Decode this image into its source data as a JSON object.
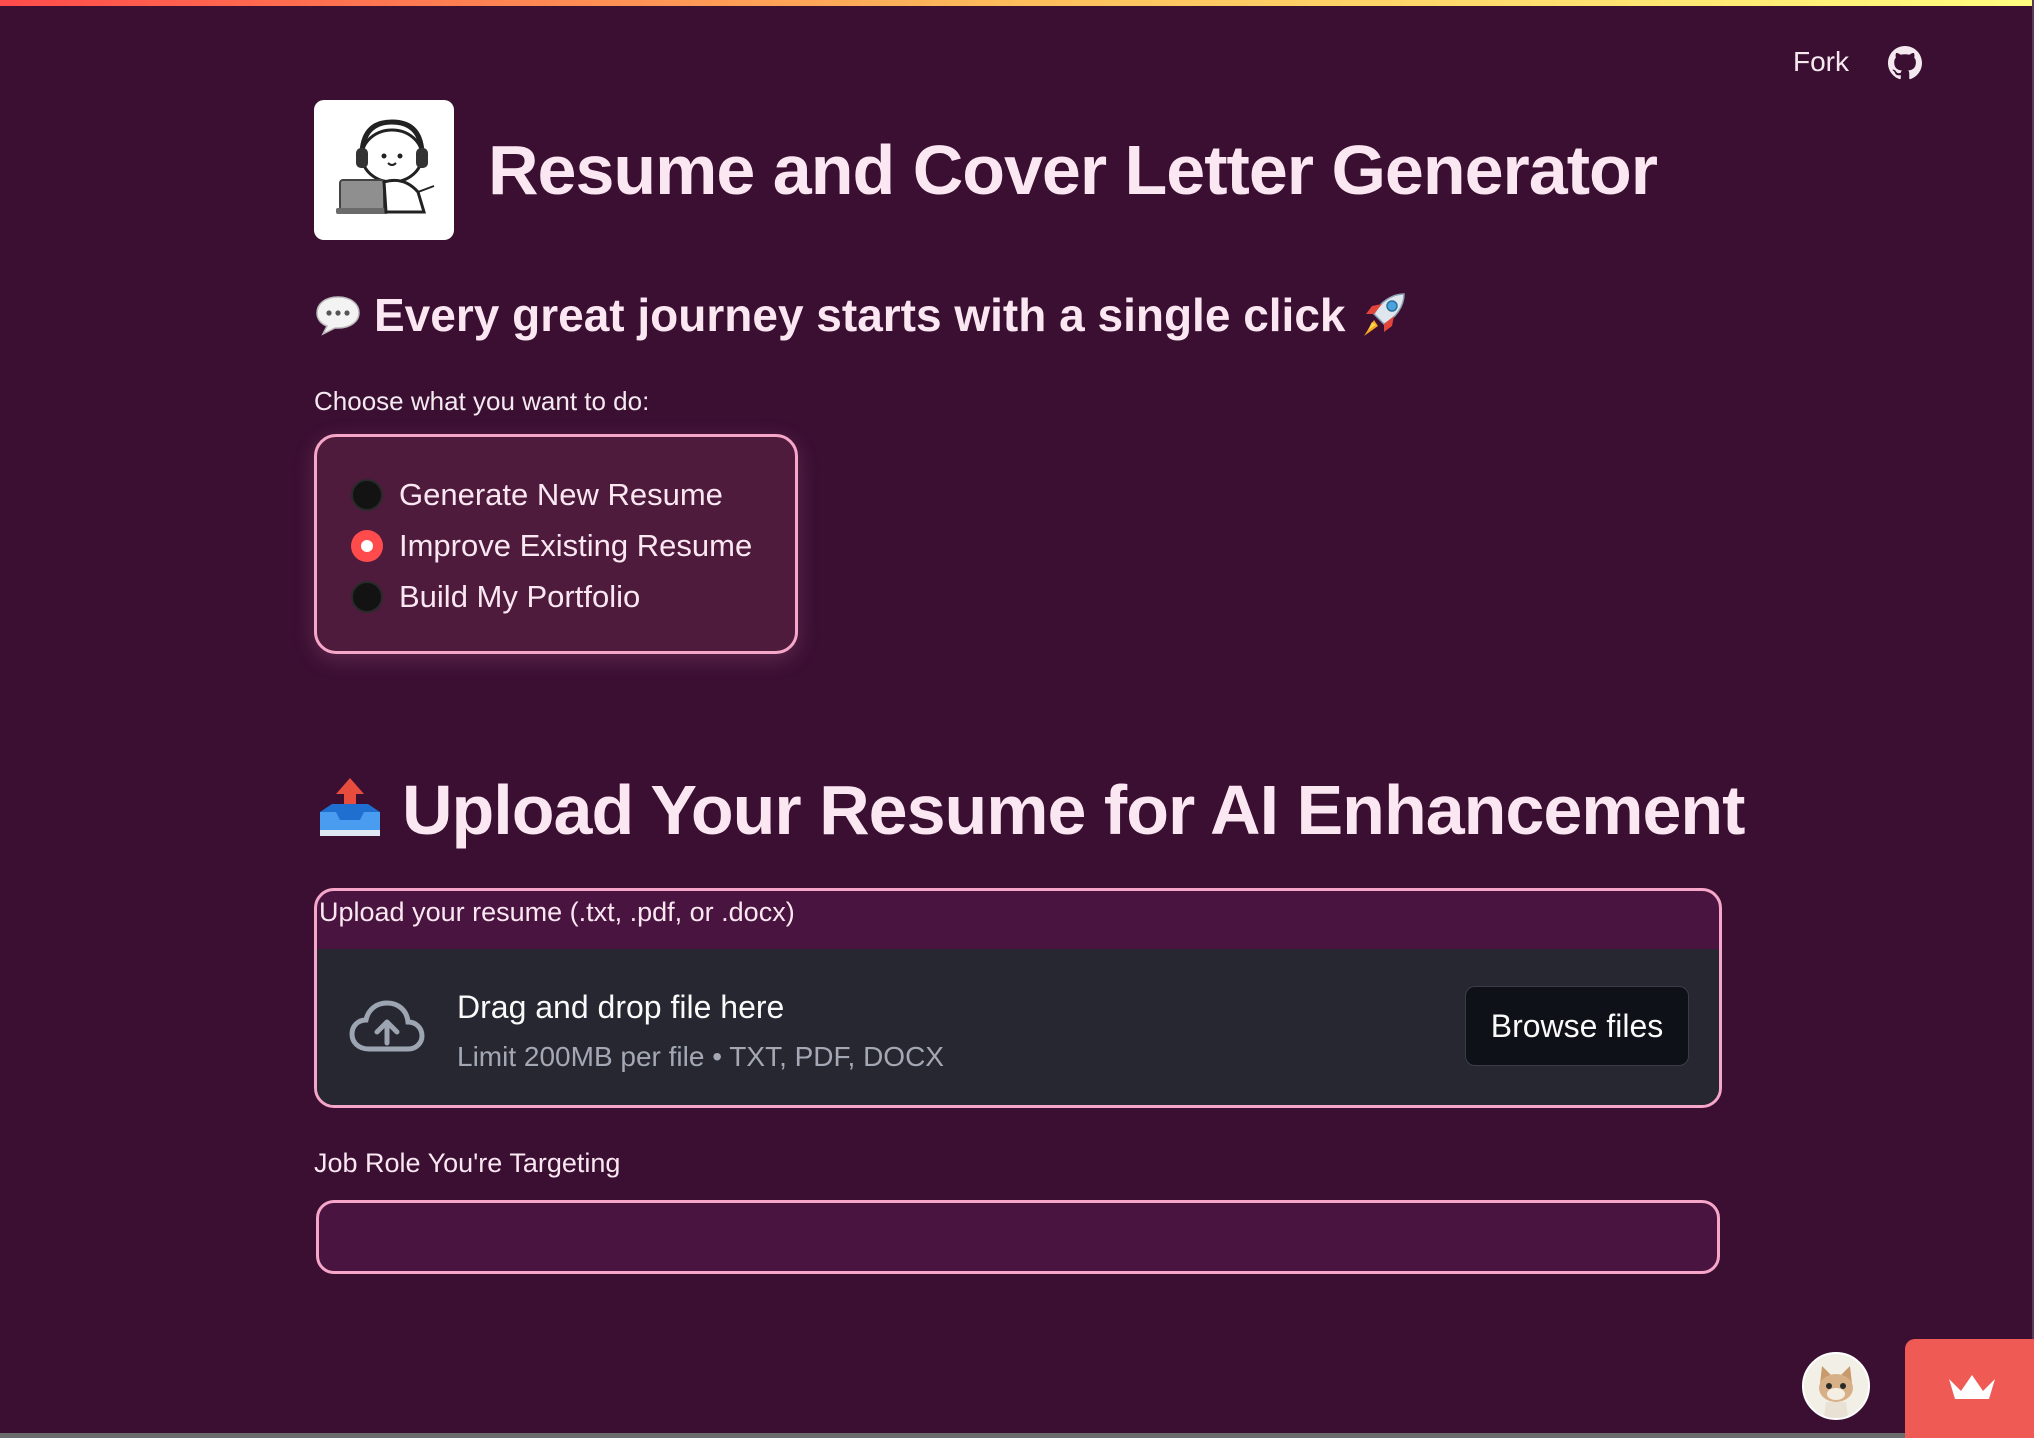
{
  "header": {
    "fork_label": "Fork",
    "github_icon": "github-icon"
  },
  "app": {
    "logo_icon": "cat-headphones-laptop-logo",
    "title": "Resume and Cover Letter Generator",
    "tagline": "Every great journey starts with a single click",
    "tagline_icons": [
      "speech-bubble-icon",
      "rocket-icon"
    ]
  },
  "mode": {
    "label": "Choose what you want to do:",
    "options": [
      "Generate New Resume",
      "Improve Existing Resume",
      "Build My Portfolio"
    ],
    "selected": "Improve Existing Resume"
  },
  "upload_section": {
    "title": "Upload Your Resume for AI Enhancement",
    "title_icon": "inbox-tray-icon",
    "uploader_label": "Upload your resume (.txt, .pdf, or .docx)",
    "drop_title": "Drag and drop file here",
    "drop_hint": "Limit 200MB per file • TXT, PDF, DOCX",
    "browse_label": "Browse files",
    "drop_icon": "cloud-upload-icon"
  },
  "job_role": {
    "label": "Job Role You're Targeting",
    "value": "",
    "placeholder": ""
  },
  "footer": {
    "avatar_icon": "cat-avatar",
    "deploy_icon": "crown-icon"
  },
  "colors": {
    "background": "#3a0f32",
    "accent_border": "#f6a6c8",
    "radio_selected": "#ff4b4b",
    "dropzone": "#262730"
  }
}
